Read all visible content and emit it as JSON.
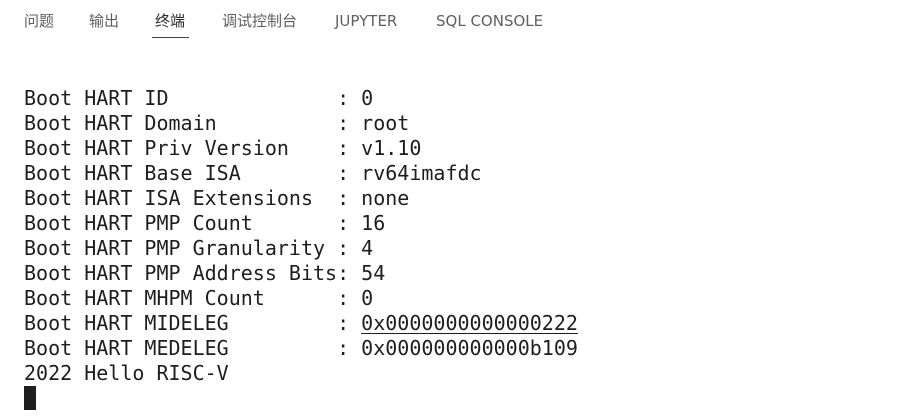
{
  "tabs": [
    {
      "label": "问题"
    },
    {
      "label": "输出"
    },
    {
      "label": "终端"
    },
    {
      "label": "调试控制台"
    },
    {
      "label": "JUPYTER"
    },
    {
      "label": "SQL CONSOLE"
    }
  ],
  "active_tab": "终端",
  "terminal": {
    "lines": [
      {
        "key": "Boot HART ID              ",
        "sep": ": ",
        "value": "0"
      },
      {
        "key": "Boot HART Domain          ",
        "sep": ": ",
        "value": "root"
      },
      {
        "key": "Boot HART Priv Version    ",
        "sep": ": ",
        "value": "v1.10"
      },
      {
        "key": "Boot HART Base ISA        ",
        "sep": ": ",
        "value": "rv64imafdc"
      },
      {
        "key": "Boot HART ISA Extensions  ",
        "sep": ": ",
        "value": "none"
      },
      {
        "key": "Boot HART PMP Count       ",
        "sep": ": ",
        "value": "16"
      },
      {
        "key": "Boot HART PMP Granularity ",
        "sep": ": ",
        "value": "4"
      },
      {
        "key": "Boot HART PMP Address Bits",
        "sep": ": ",
        "value": "54"
      },
      {
        "key": "Boot HART MHPM Count      ",
        "sep": ": ",
        "value": "0"
      },
      {
        "key": "Boot HART MIDELEG         ",
        "sep": ": ",
        "value": "0x0000000000000222"
      },
      {
        "key": "Boot HART MEDELEG         ",
        "sep": ": ",
        "value": "0x000000000000b109"
      }
    ],
    "output": "2022 Hello RISC-V"
  },
  "colors": {
    "tab_text": "#5f5f5f",
    "tab_active_text": "#2b2b2b",
    "tab_underline": "#424242",
    "terminal_text": "#1e1e1e",
    "background": "#ffffff"
  }
}
